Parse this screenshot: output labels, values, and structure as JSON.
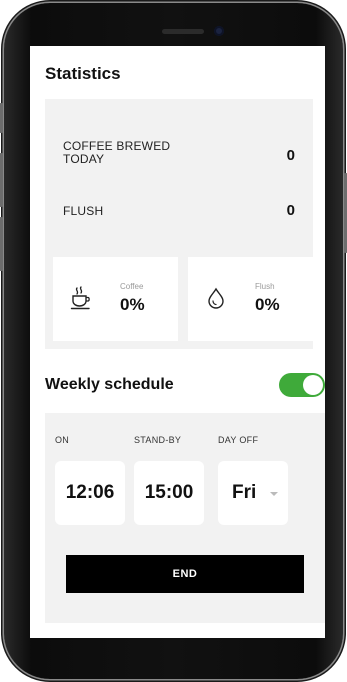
{
  "statistics": {
    "title": "Statistics",
    "coffee_brewed": {
      "label": "COFFEE BREWED TODAY",
      "value": "0"
    },
    "flush": {
      "label": "FLUSH",
      "value": "0"
    },
    "cards": [
      {
        "label": "Coffee",
        "value": "0%",
        "icon": "coffee-cup-icon"
      },
      {
        "label": "Flush",
        "value": "0%",
        "icon": "water-drop-icon"
      }
    ]
  },
  "weekly": {
    "title": "Weekly schedule",
    "enabled": true,
    "toggle_color": "#3faa3a",
    "columns": {
      "on_label": "ON",
      "standby_label": "STAND-BY",
      "dayoff_label": "DAY OFF"
    },
    "on_time": "12:06",
    "standby_time": "15:00",
    "day_off": "Fri",
    "end_label": "END"
  }
}
